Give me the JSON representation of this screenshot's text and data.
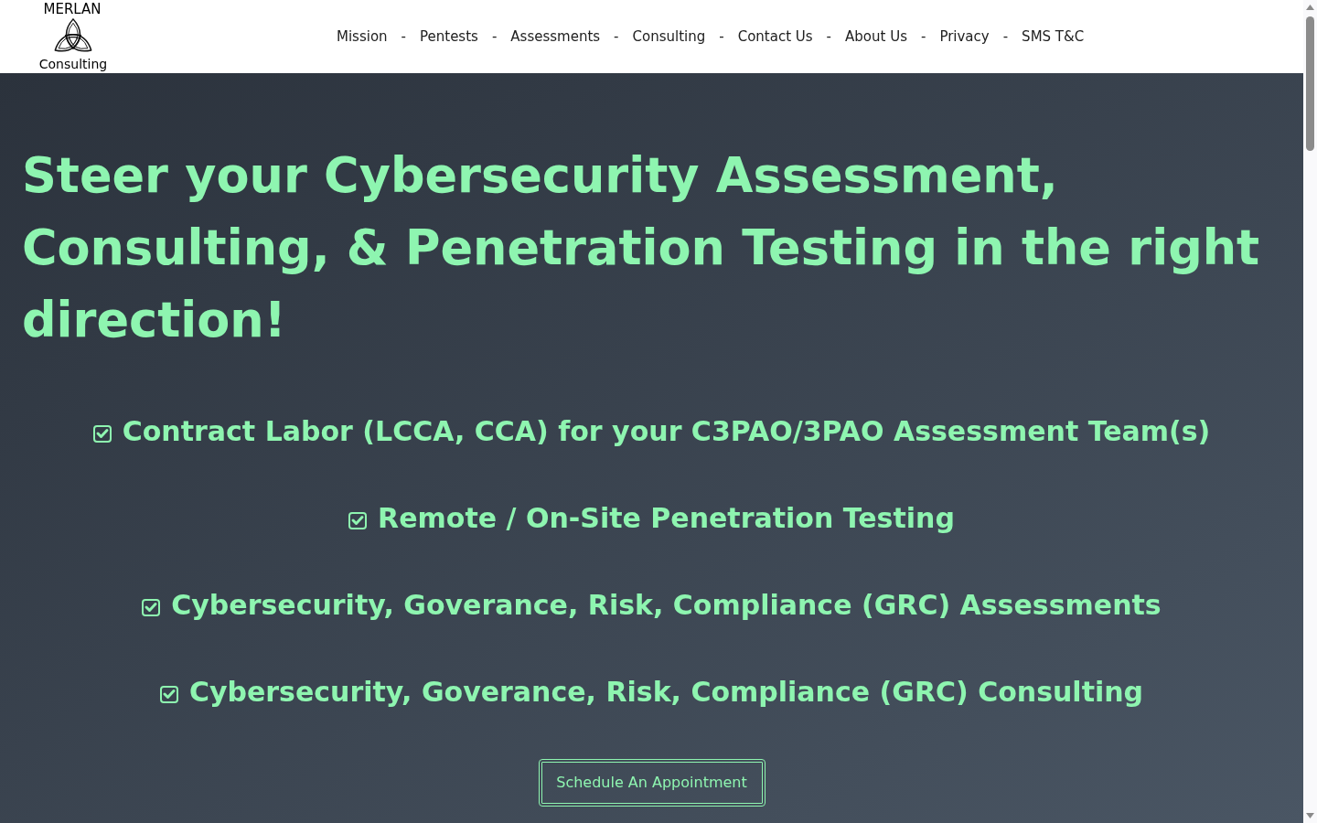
{
  "header": {
    "logo": {
      "top_text": "MERLAN",
      "bottom_text": "Consulting"
    },
    "nav": [
      {
        "kind": "link",
        "label": "Mission"
      },
      {
        "kind": "separator",
        "label": "-"
      },
      {
        "kind": "link",
        "label": "Pentests"
      },
      {
        "kind": "separator",
        "label": "-"
      },
      {
        "kind": "link",
        "label": "Assessments"
      },
      {
        "kind": "separator",
        "label": "-"
      },
      {
        "kind": "link",
        "label": "Consulting"
      },
      {
        "kind": "separator",
        "label": "-"
      },
      {
        "kind": "link",
        "label": "Contact Us"
      },
      {
        "kind": "separator",
        "label": "-"
      },
      {
        "kind": "link",
        "label": "About Us"
      },
      {
        "kind": "separator",
        "label": "-"
      },
      {
        "kind": "link",
        "label": "Privacy"
      },
      {
        "kind": "separator",
        "label": "-"
      },
      {
        "kind": "link",
        "label": "SMS T&C"
      }
    ]
  },
  "hero": {
    "heading": "Steer your Cybersecurity Assessment, Consulting, & Penetration Testing in the right direction!",
    "features": [
      "Contract Labor (LCCA, CCA) for your C3PAO/3PAO Assessment Team(s)",
      "Remote / On-Site Penetration Testing",
      "Cybersecurity, Goverance, Risk, Compliance (GRC) Assessments",
      "Cybersecurity, Goverance, Risk, Compliance (GRC) Consulting"
    ],
    "cta_button": "Schedule An Appointment"
  }
}
